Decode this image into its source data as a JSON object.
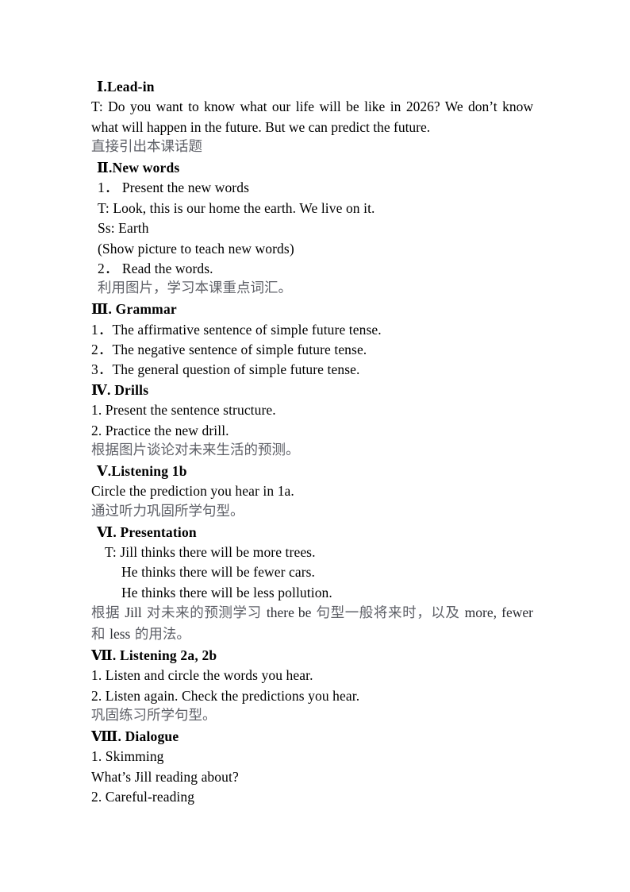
{
  "document": {
    "type": "lesson-plan",
    "language": "en-zh",
    "colors": {
      "text": "#000000",
      "annotation": "#5f6168",
      "background": "#ffffff"
    },
    "sections": [
      {
        "id": "lead-in",
        "numeral": "Ⅰ",
        "heading": "Ⅰ.Lead-in",
        "lines": [
          "T: Do you want to know what our life will be like in 2026? We don’t know what will happen in the future. But we can predict the future."
        ],
        "annotation": "直接引出本课话题"
      },
      {
        "id": "new-words",
        "numeral": "Ⅱ",
        "heading": "Ⅱ.New words",
        "lines": [
          "1． Present the new words",
          "T: Look, this is our home the earth. We live on it.",
          "Ss: Earth",
          "(Show picture to teach new words)",
          "2． Read the words."
        ],
        "annotation": "利用图片，学习本课重点词汇。"
      },
      {
        "id": "grammar",
        "numeral": "Ⅲ",
        "heading": "Ⅲ. Grammar",
        "lines": [
          "1．The affirmative sentence of simple future tense.",
          "2．The negative sentence of simple future tense.",
          "3．The general question of simple future tense."
        ],
        "annotation": ""
      },
      {
        "id": "drills",
        "numeral": "Ⅳ",
        "heading": "Ⅳ. Drills",
        "lines": [
          "1. Present the sentence structure.",
          "2. Practice the new drill."
        ],
        "annotation": "根据图片谈论对未来生活的预测。"
      },
      {
        "id": "listening-1b",
        "numeral": "Ⅴ",
        "heading": "Ⅴ.Listening 1b",
        "lines": [
          "Circle the prediction you hear in 1a."
        ],
        "annotation": "通过听力巩固所学句型。"
      },
      {
        "id": "presentation",
        "numeral": "Ⅵ",
        "heading": "Ⅵ. Presentation",
        "lines": [
          "T: Jill thinks there will be more trees.",
          "He thinks there will be fewer cars.",
          "He thinks there will be less pollution."
        ],
        "annotation_mixed": [
          {
            "text": "根据 ",
            "lang": "zh"
          },
          {
            "text": "Jill",
            "lang": "en"
          },
          {
            "text": " 对未来的预测学习 ",
            "lang": "zh"
          },
          {
            "text": "there be",
            "lang": "en"
          },
          {
            "text": " 句型一般将来时，以及 ",
            "lang": "zh"
          },
          {
            "text": "more, fewer",
            "lang": "en"
          },
          {
            "text": " 和 ",
            "lang": "zh"
          },
          {
            "text": "less",
            "lang": "en"
          },
          {
            "text": " 的用法。",
            "lang": "zh"
          }
        ]
      },
      {
        "id": "listening-2a-2b",
        "numeral": "Ⅶ",
        "heading": "Ⅶ. Listening 2a, 2b",
        "lines": [
          "1. Listen and circle the words you hear.",
          "2. Listen again. Check the predictions you hear."
        ],
        "annotation": "巩固练习所学句型。"
      },
      {
        "id": "dialogue",
        "numeral": "Ⅷ",
        "heading": "Ⅷ. Dialogue",
        "lines": [
          "1. Skimming",
          "What’s Jill reading about?",
          "2. Careful-reading"
        ],
        "annotation": ""
      }
    ]
  },
  "s1": {
    "heading": "Ⅰ.Lead-in",
    "para": "T: Do you want to know what our life will be like in 2026? We don’t know what will happen in the future. But we can predict the future.",
    "annotation": "直接引出本课话题"
  },
  "s2": {
    "heading": "Ⅱ.New words",
    "l1": "1． Present the new words",
    "l2": "T: Look, this is our home the earth. We live on it.",
    "l3": "Ss: Earth",
    "l4": "(Show picture to teach new words)",
    "l5": "2． Read the words.",
    "annotation": "利用图片，学习本课重点词汇。"
  },
  "s3": {
    "heading": "Ⅲ. Grammar",
    "l1": "1．The affirmative sentence of simple future tense.",
    "l2": "2．The negative sentence of simple future tense.",
    "l3": "3．The general question of simple future tense."
  },
  "s4": {
    "heading": "Ⅳ. Drills",
    "l1": "1. Present the sentence structure.",
    "l2": "2. Practice the new drill.",
    "annotation": "根据图片谈论对未来生活的预测。"
  },
  "s5": {
    "heading": "Ⅴ.Listening 1b",
    "l1": "Circle the prediction you hear in 1a.",
    "annotation": "通过听力巩固所学句型。"
  },
  "s6": {
    "heading": "Ⅵ. Presentation",
    "l1": "T: Jill thinks there will be more trees.",
    "l2": "He thinks there will be fewer cars.",
    "l3": "He thinks there will be less pollution.",
    "ann_a": "根据 ",
    "ann_b": "Jill",
    "ann_c": " 对未来的预测学习 ",
    "ann_d": "there be",
    "ann_e": " 句型一般将来时，以及 ",
    "ann_f": "more,",
    "ann_g": "fewer",
    "ann_h": " 和 ",
    "ann_i": "less",
    "ann_j": " 的用法。"
  },
  "s7": {
    "heading": "Ⅶ. Listening 2a, 2b",
    "l1": "1. Listen and circle the words you hear.",
    "l2": "2. Listen again. Check the predictions you hear.",
    "annotation": "巩固练习所学句型。"
  },
  "s8": {
    "heading": "Ⅷ. Dialogue",
    "l1": "1. Skimming",
    "l2": "What’s Jill reading about?",
    "l3": "2. Careful-reading"
  }
}
